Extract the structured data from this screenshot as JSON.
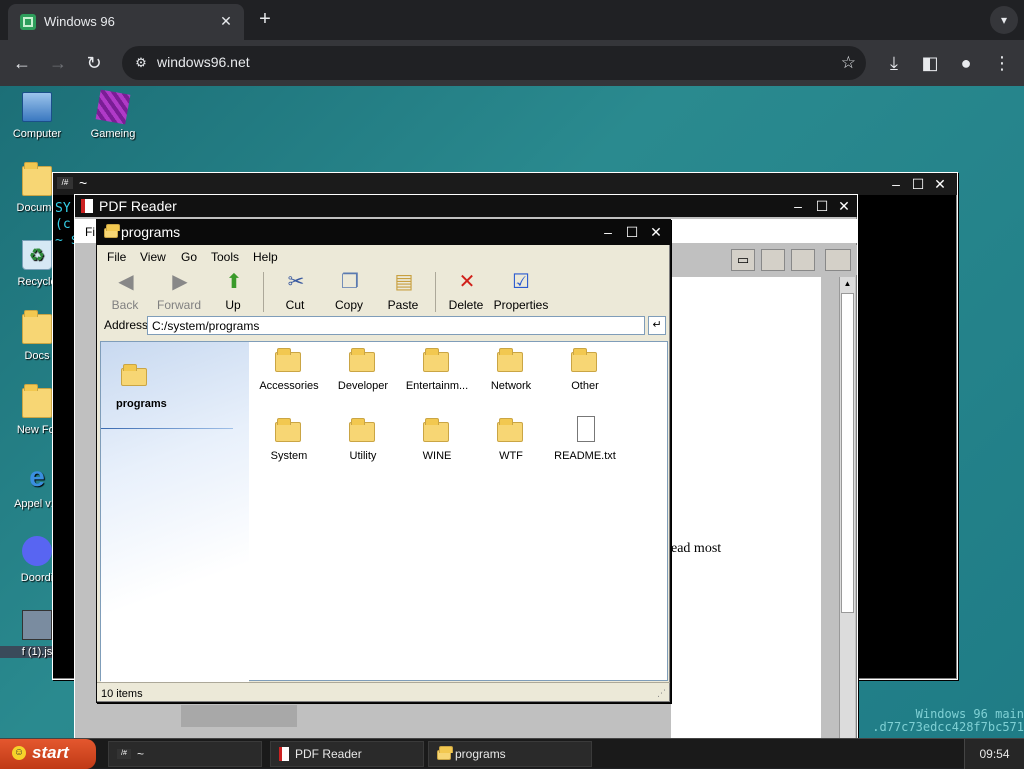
{
  "browser": {
    "tab_title": "Windows 96",
    "url": "windows96.net",
    "tab_close": "✕",
    "new_tab": "+"
  },
  "desktop": {
    "icons": [
      {
        "label": "Computer"
      },
      {
        "label": "Gameing"
      },
      {
        "label": "Docume"
      },
      {
        "label": "Recycle"
      },
      {
        "label": "Docs"
      },
      {
        "label": "New Fol"
      },
      {
        "label": "Appel v1."
      },
      {
        "label": "Doordi"
      },
      {
        "label": "f (1).js"
      }
    ],
    "watermark_line1": "Windows 96 main",
    "watermark_line2": ".d77c73edcc428f7bc571"
  },
  "terminal": {
    "title": "~",
    "text_line1": "SY",
    "text_line2": "(c",
    "text_line3": "~ $"
  },
  "pdf_reader": {
    "title": "PDF Reader",
    "menu_partial": "Fi",
    "page_text": "ead most"
  },
  "explorer": {
    "title": "programs",
    "menu": [
      "File",
      "View",
      "Go",
      "Tools",
      "Help"
    ],
    "toolbar": {
      "back": "Back",
      "forward": "Forward",
      "up": "Up",
      "cut": "Cut",
      "copy": "Copy",
      "paste": "Paste",
      "delete": "Delete",
      "properties": "Properties"
    },
    "address_label": "Address",
    "address_value": "C:/system/programs",
    "pane_title": "programs",
    "items": [
      {
        "label": "Accessories",
        "type": "folder"
      },
      {
        "label": "Developer",
        "type": "folder"
      },
      {
        "label": "Entertainm...",
        "type": "folder"
      },
      {
        "label": "Network",
        "type": "folder"
      },
      {
        "label": "Other",
        "type": "folder"
      },
      {
        "label": "System",
        "type": "folder"
      },
      {
        "label": "Utility",
        "type": "folder"
      },
      {
        "label": "WINE",
        "type": "folder"
      },
      {
        "label": "WTF",
        "type": "folder"
      },
      {
        "label": "README.txt",
        "type": "file"
      }
    ],
    "status": "10 items"
  },
  "taskbar": {
    "start_label": "start",
    "tasks": [
      {
        "label": "~"
      },
      {
        "label": "PDF Reader"
      },
      {
        "label": "programs"
      }
    ],
    "clock": "09:54"
  }
}
